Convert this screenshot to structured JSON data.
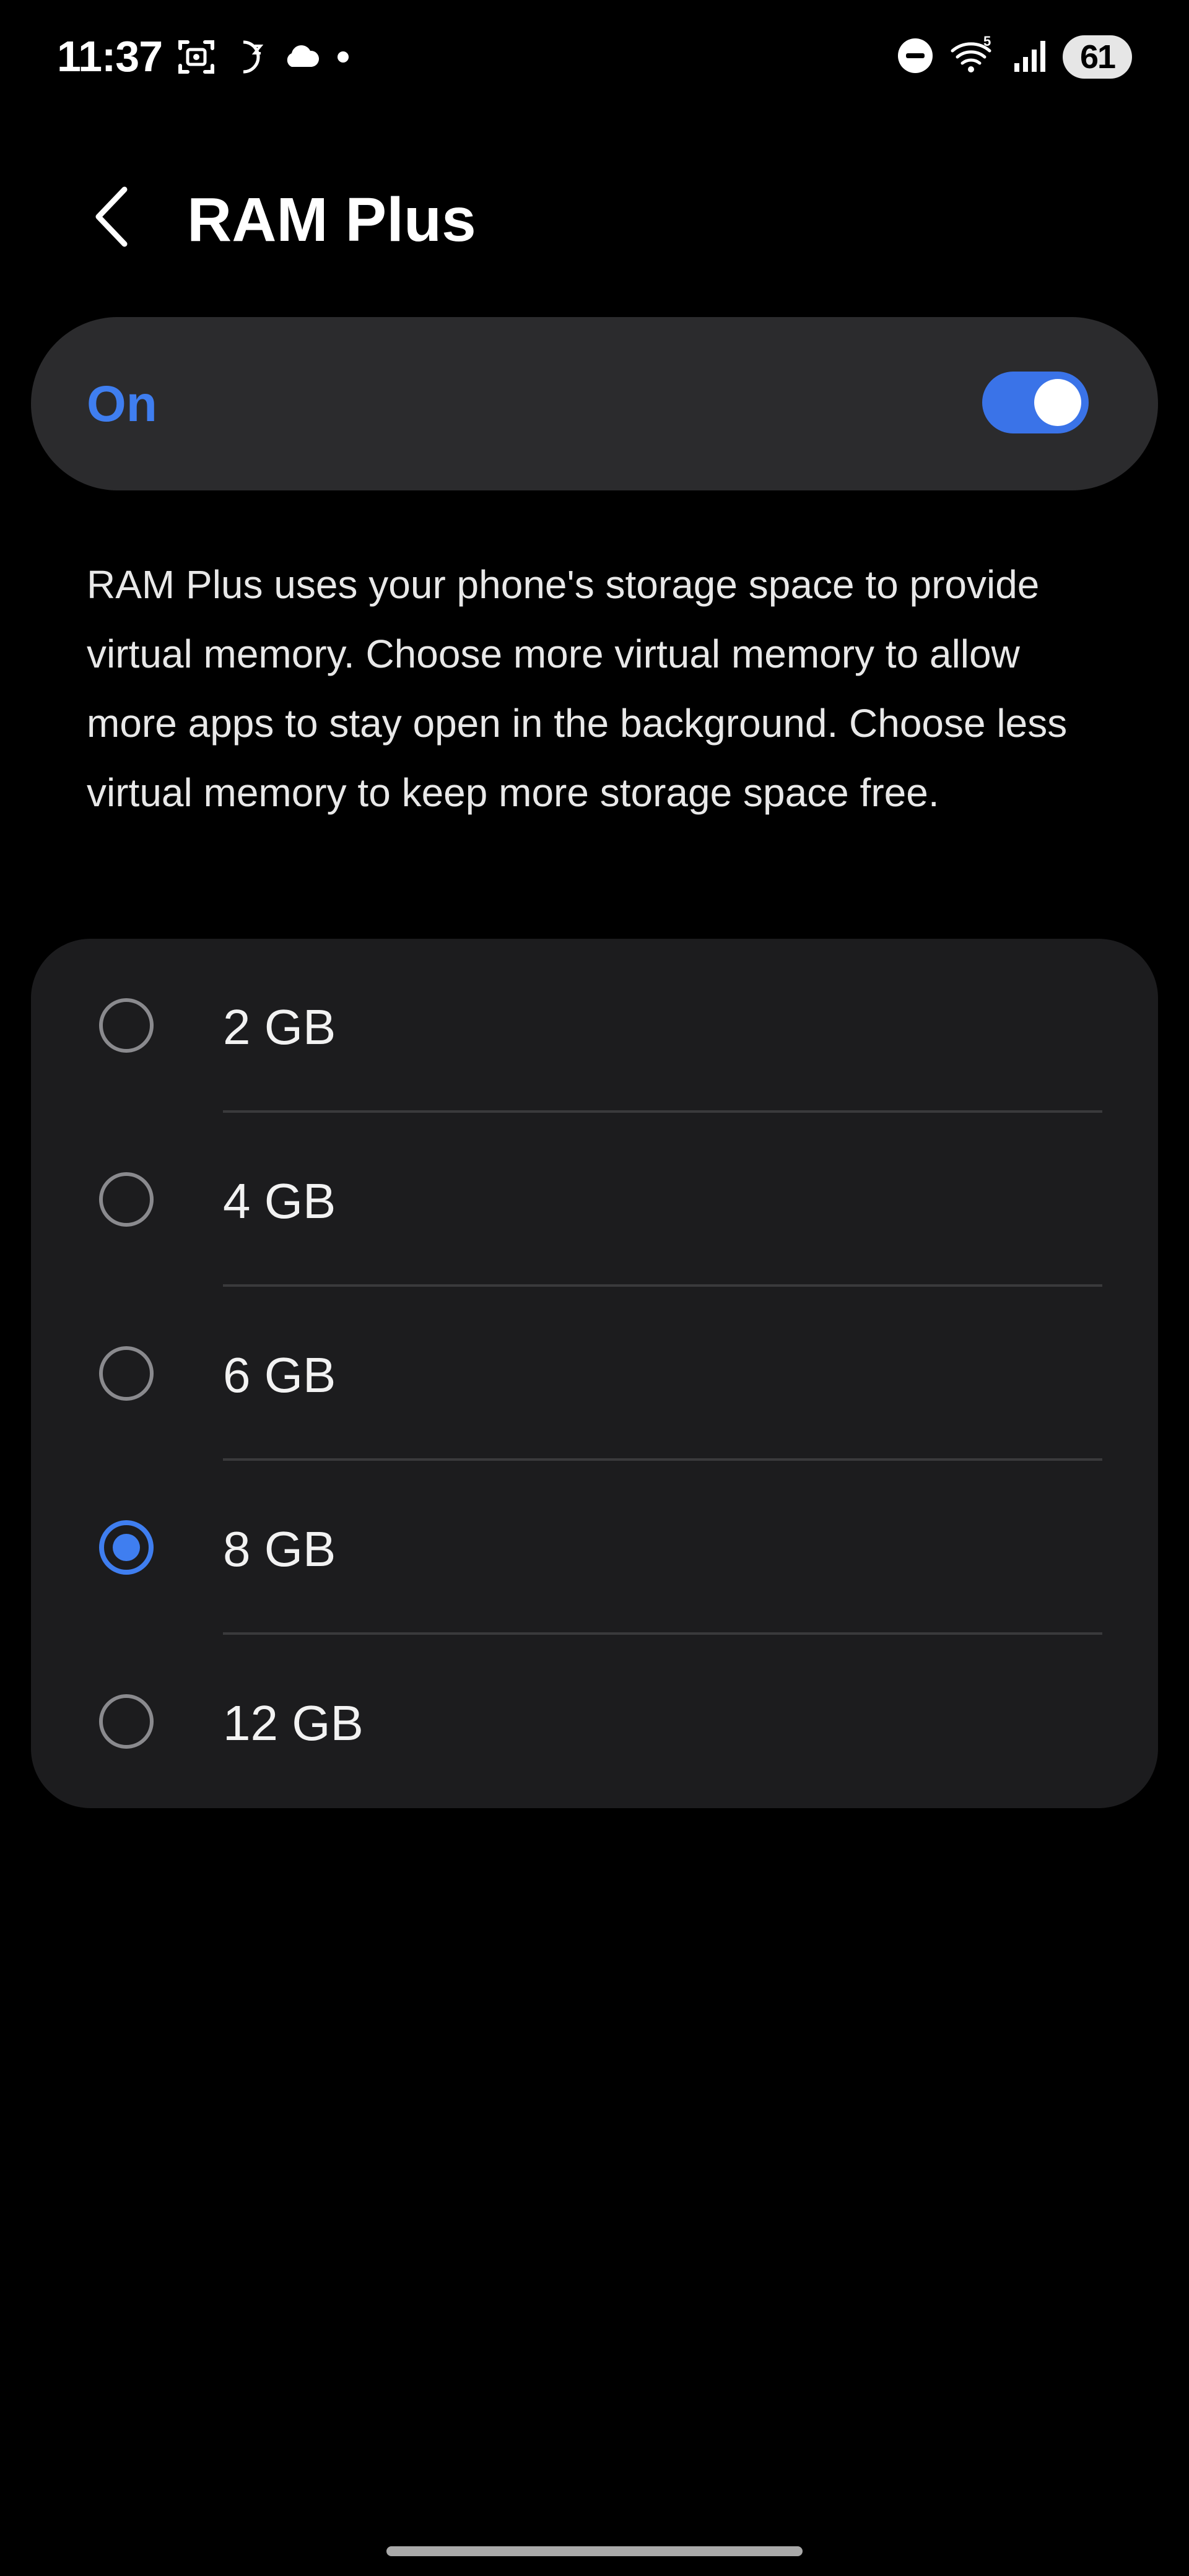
{
  "status_bar": {
    "time": "11:37",
    "left_icons": [
      "screen-capture-icon",
      "moon-icon",
      "cloud-icon",
      "dot-icon"
    ],
    "right_icons": [
      "do-not-disturb-icon",
      "wifi-icon",
      "signal-icon"
    ],
    "wifi_badge": "5",
    "battery_level": "61"
  },
  "header": {
    "back_icon": "chevron-left-icon",
    "title": "RAM Plus"
  },
  "master_toggle": {
    "label": "On",
    "enabled": true,
    "accent_color": "#3f7ef0"
  },
  "description": "RAM Plus uses your phone's storage space to provide virtual memory. Choose more virtual memory to allow more apps to stay open in the background. Choose less virtual memory to keep more storage space free.",
  "options": {
    "selected": "8 GB",
    "items": [
      {
        "label": "2 GB",
        "checked": false
      },
      {
        "label": "4 GB",
        "checked": false
      },
      {
        "label": "6 GB",
        "checked": false
      },
      {
        "label": "8 GB",
        "checked": true
      },
      {
        "label": "12 GB",
        "checked": false
      }
    ]
  }
}
